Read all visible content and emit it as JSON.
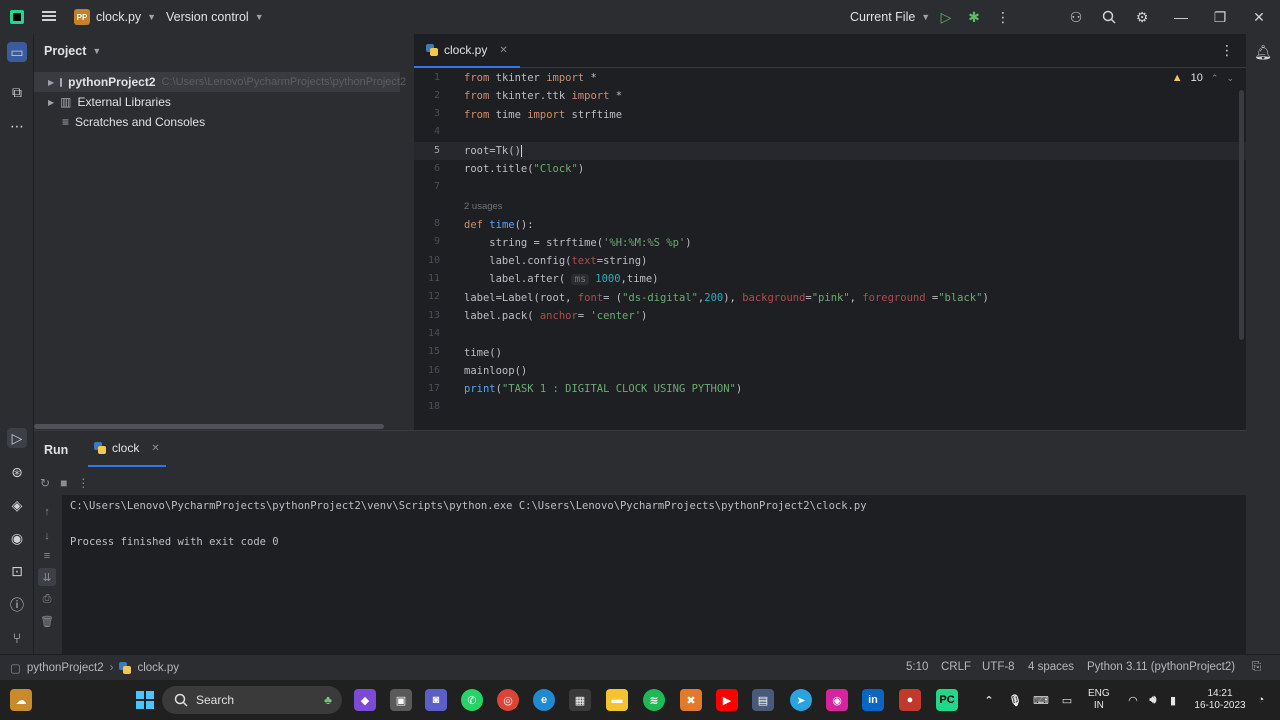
{
  "titlebar": {
    "project_badge": "PP",
    "file_menu": "clock.py",
    "vcs_menu": "Version control",
    "run_config": "Current File"
  },
  "project_panel": {
    "title": "Project",
    "items": [
      {
        "label": "pythonProject2",
        "path": "C:\\Users\\Lenovo\\PycharmProjects\\pythonProject2"
      },
      {
        "label": "External Libraries"
      },
      {
        "label": "Scratches and Consoles"
      }
    ]
  },
  "editor": {
    "tab_label": "clock.py",
    "warning_count": "10",
    "usages_hint": "2 usages",
    "line_numbers": [
      "1",
      "2",
      "3",
      "4",
      "5",
      "6",
      "7",
      "8",
      "9",
      "10",
      "11",
      "12",
      "13",
      "14",
      "15",
      "16",
      "17",
      "18"
    ],
    "current_line": "5"
  },
  "run_panel": {
    "title": "Run",
    "tab_label": "clock",
    "output": [
      "C:\\Users\\Lenovo\\PycharmProjects\\pythonProject2\\venv\\Scripts\\python.exe C:\\Users\\Lenovo\\PycharmProjects\\pythonProject2\\clock.py",
      "Process finished with exit code 0"
    ]
  },
  "statusbar": {
    "breadcrumb_project": "pythonProject2",
    "breadcrumb_file": "clock.py",
    "position": "5:10",
    "line_ending": "CRLF",
    "encoding": "UTF-8",
    "indent": "4 spaces",
    "interpreter": "Python 3.11 (pythonProject2)"
  },
  "taskbar": {
    "search_label": "Search",
    "lang_top": "ENG",
    "lang_bottom": "IN",
    "time": "14:21",
    "date": "16-10-2023"
  },
  "colors": {
    "accent": "#3574f0",
    "keyword": "#cf8e6d",
    "string": "#6aab73",
    "function": "#56a8f5",
    "number": "#2aacb8"
  }
}
